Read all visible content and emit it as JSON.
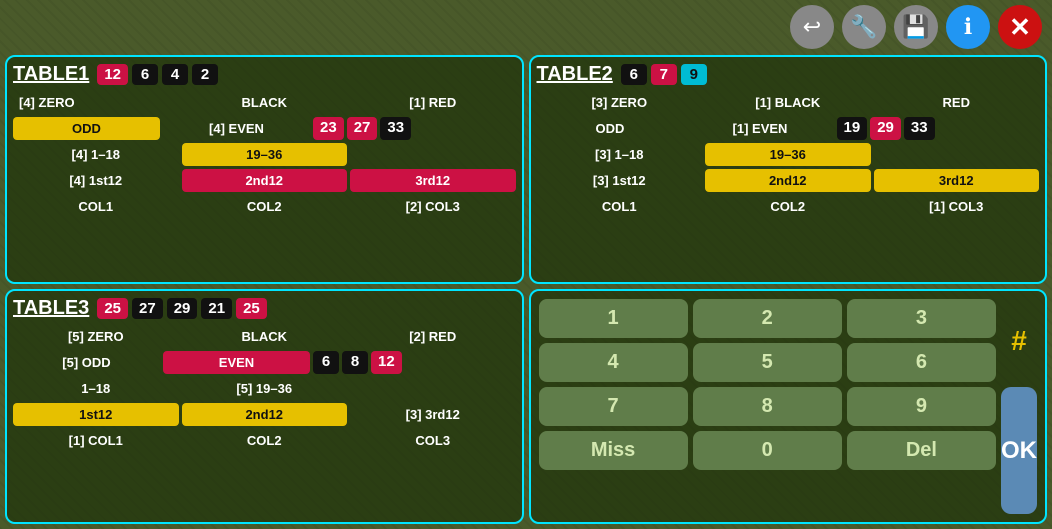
{
  "toolbar": {
    "back_label": "↩",
    "wrench_label": "🔧",
    "save_label": "💾",
    "info_label": "ℹ",
    "close_label": "✕"
  },
  "table1": {
    "title": "TABLE1",
    "badges": [
      {
        "value": "12",
        "type": "red"
      },
      {
        "value": "6",
        "type": "black"
      },
      {
        "value": "4",
        "type": "black"
      },
      {
        "value": "2",
        "type": "black"
      }
    ],
    "rows": [
      {
        "left": "[4] ZERO",
        "mid": "BLACK",
        "right": "[1] RED"
      },
      {
        "left": "ODD",
        "mid": "[4] EVEN",
        "right": "23 27 33"
      },
      {
        "left": "[4] 1–18",
        "mid": "19–36",
        "right": ""
      },
      {
        "left": "[4] 1st12",
        "mid": "2nd12",
        "right": "3rd12"
      },
      {
        "left": "COL1",
        "mid": "COL2",
        "right": "[2] COL3"
      }
    ]
  },
  "table2": {
    "title": "TABLE2",
    "badges": [
      {
        "value": "6",
        "type": "black"
      },
      {
        "value": "7",
        "type": "red"
      },
      {
        "value": "9",
        "type": "cyan"
      }
    ],
    "rows": [
      {
        "left": "[3] ZERO",
        "mid": "[1] BLACK",
        "right": "RED"
      },
      {
        "left": "ODD",
        "mid": "[1] EVEN",
        "right": "19 29 33"
      },
      {
        "left": "[3] 1–18",
        "mid": "19–36",
        "right": ""
      },
      {
        "left": "[3] 1st12",
        "mid": "2nd12",
        "right": "3rd12"
      },
      {
        "left": "COL1",
        "mid": "COL2",
        "right": "[1] COL3"
      }
    ]
  },
  "table3": {
    "title": "TABLE3",
    "badges": [
      {
        "value": "25",
        "type": "red"
      },
      {
        "value": "27",
        "type": "black"
      },
      {
        "value": "29",
        "type": "black"
      },
      {
        "value": "21",
        "type": "black"
      },
      {
        "value": "25",
        "type": "red"
      }
    ],
    "rows": [
      {
        "left": "[5] ZERO",
        "mid": "BLACK",
        "right": "[2] RED"
      },
      {
        "left": "[5] ODD",
        "mid": "EVEN",
        "right": "6 8 12"
      },
      {
        "left": "1–18",
        "mid": "[5] 19–36",
        "right": ""
      },
      {
        "left": "1st12",
        "mid": "2nd12",
        "right": "[3] 3rd12"
      },
      {
        "left": "[1] COL1",
        "mid": "COL2",
        "right": "COL3"
      }
    ]
  },
  "numpad": {
    "buttons": [
      "1",
      "2",
      "3",
      "4",
      "5",
      "6",
      "7",
      "8",
      "9",
      "Miss",
      "0",
      "Del"
    ],
    "hash": "#",
    "ok": "OK"
  }
}
